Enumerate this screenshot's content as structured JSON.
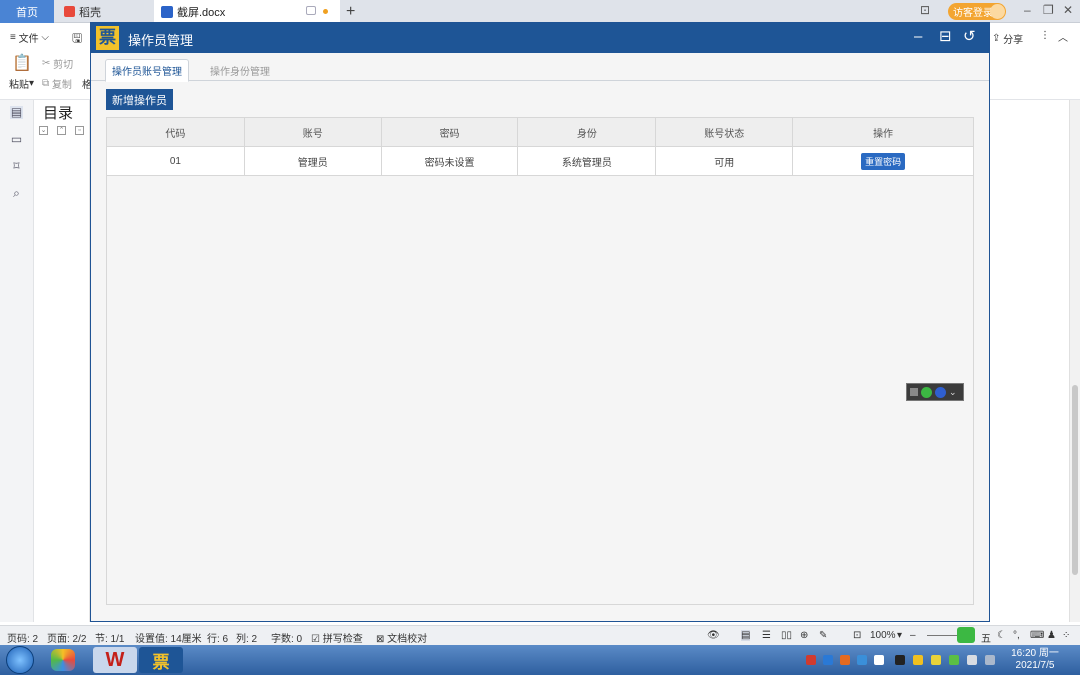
{
  "browser_tabs": {
    "home": "首页",
    "docer": "稻壳",
    "doc": "截屏.docx",
    "add": "+"
  },
  "login": "访客登录",
  "ribbon": {
    "file": "文件",
    "cut": "剪切",
    "copy": "复制",
    "paste": "粘贴",
    "format": "格",
    "share": "分享"
  },
  "toc": {
    "title": "目录"
  },
  "app": {
    "title": "操作员管理",
    "logo": "票",
    "tabs": {
      "active": "操作员账号管理",
      "inactive": "操作身份管理"
    },
    "add_button": "新增操作员",
    "table": {
      "headers": [
        "代码",
        "账号",
        "密码",
        "身份",
        "账号状态",
        "操作"
      ],
      "rows": [
        {
          "code": "01",
          "account": "管理员",
          "password": "密码未设置",
          "role": "系统管理员",
          "status": "可用",
          "action": "重置密码"
        }
      ]
    }
  },
  "statusbar": {
    "page_code": "页码: 2",
    "pages": "页面: 2/2",
    "section": "节: 1/1",
    "setting": "设置值: 14厘米",
    "row": "行: 6",
    "col": "列: 2",
    "words": "字数: 0",
    "spell": "拼写检查",
    "proof": "文档校对",
    "zoom": "100%"
  },
  "taskbar": {
    "time": "16:20 周一",
    "date": "2021/7/5"
  }
}
